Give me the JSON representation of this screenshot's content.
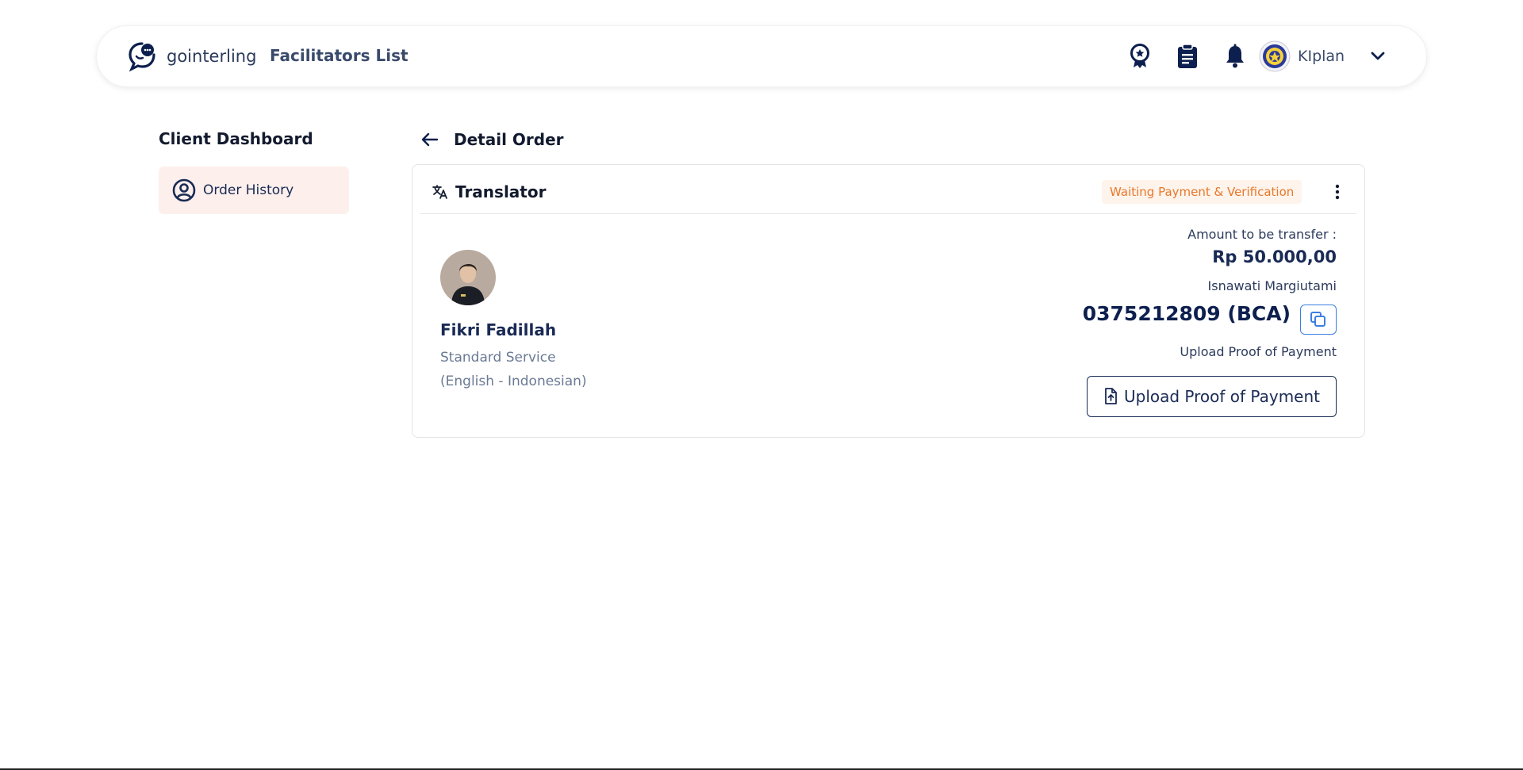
{
  "header": {
    "brand_name": "gointerling",
    "nav_link": "Facilitators List",
    "icons": [
      "award-icon",
      "clipboard-icon",
      "bell-icon"
    ],
    "user": {
      "name": "KIplan"
    }
  },
  "sidebar": {
    "title": "Client Dashboard",
    "items": [
      {
        "label": "Order History",
        "icon": "user-circle-icon"
      }
    ]
  },
  "main": {
    "title": "Detail Order",
    "order": {
      "service_type": "Translator",
      "status": "Waiting Payment & Verification",
      "facilitator": {
        "name": "Fikri Fadillah",
        "service_level": "Standard Service",
        "language_pair": "(English - Indonesian)"
      },
      "payment": {
        "amount_label": "Amount to be transfer :",
        "amount": "Rp 50.000,00",
        "account_holder": "Isnawati Margiutami",
        "account_number": "0375212809 (BCA)",
        "upload_label": "Upload Proof of Payment",
        "upload_button_label": "Upload Proof of Payment"
      }
    }
  },
  "colors": {
    "primary": "#0d1f4e",
    "status_text": "#e8782b",
    "status_bg": "#fef4ec",
    "sidebar_active_bg": "#fdf0ec",
    "copy_border": "#3b7fe0"
  }
}
